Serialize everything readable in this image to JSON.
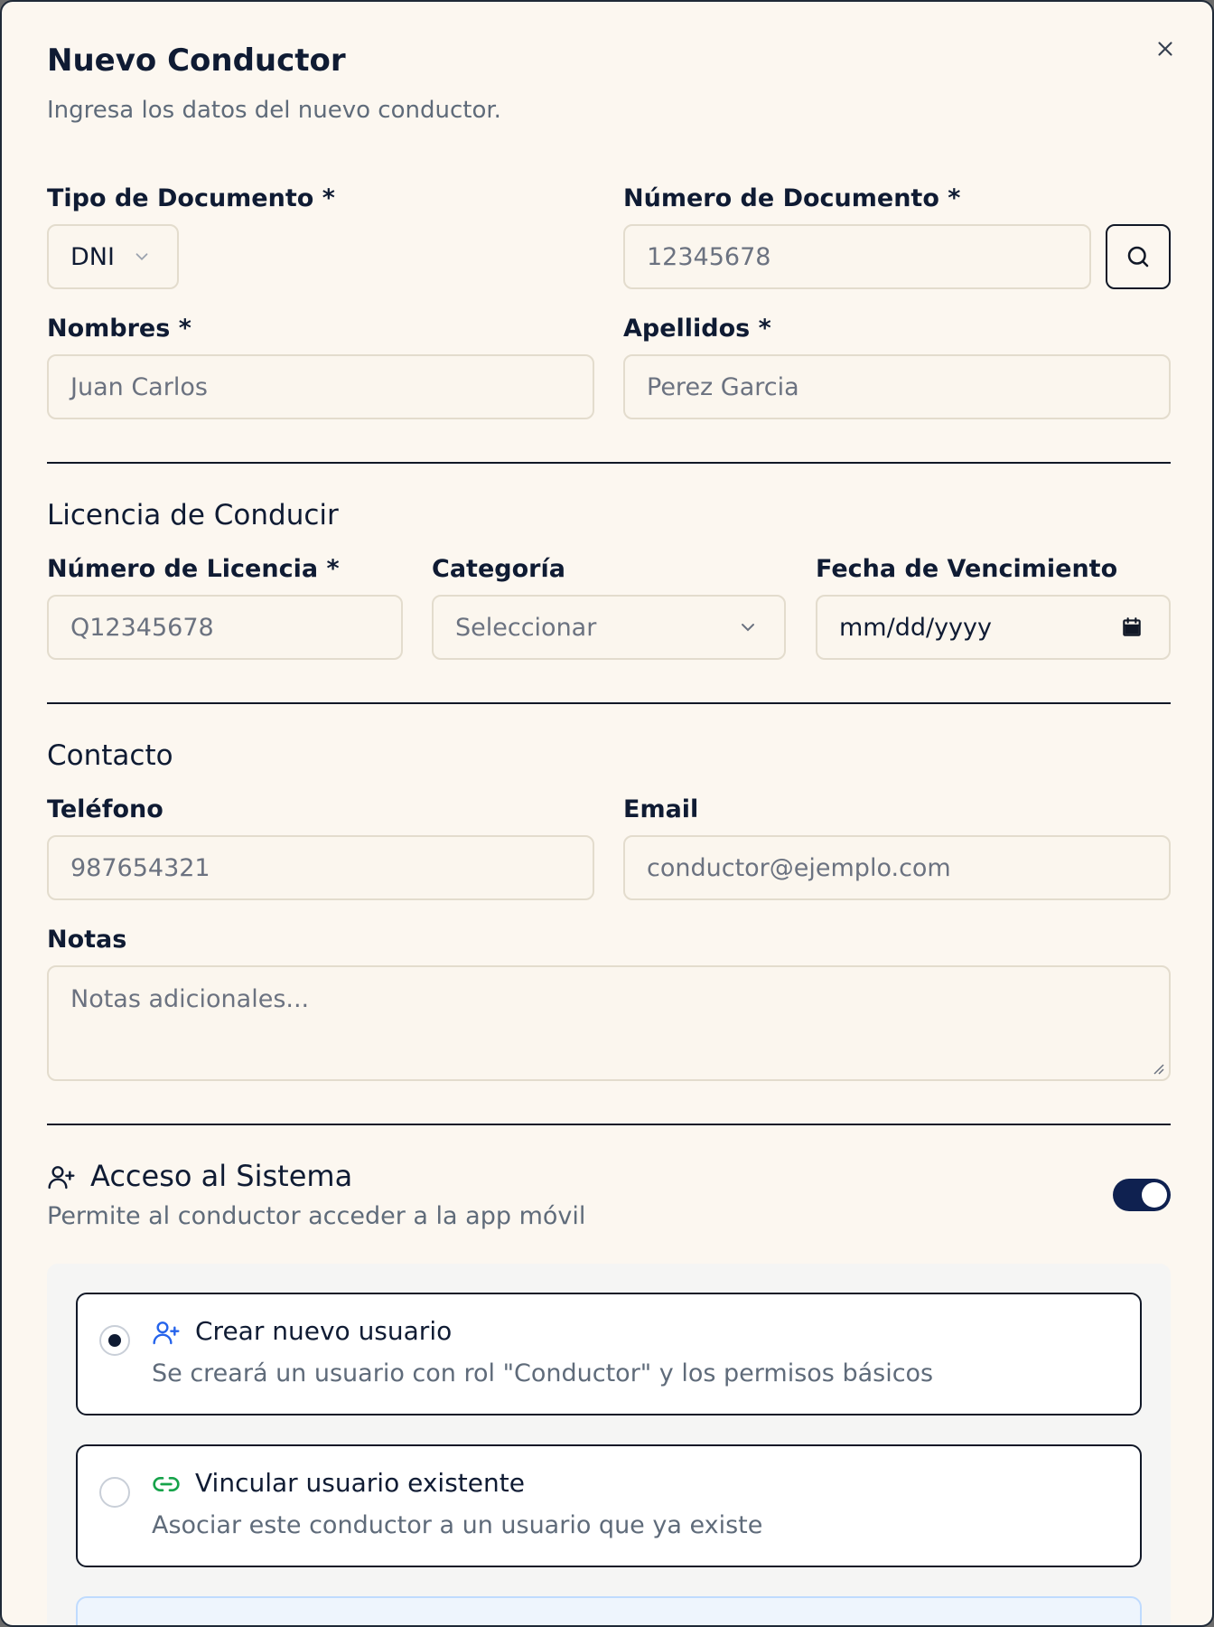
{
  "dialog": {
    "title": "Nuevo Conductor",
    "subtitle": "Ingresa los datos del nuevo conductor."
  },
  "personal": {
    "doc_type_label": "Tipo de Documento *",
    "doc_type_value": "DNI",
    "doc_number_label": "Número de Documento *",
    "doc_number_placeholder": "12345678",
    "first_name_label": "Nombres *",
    "first_name_placeholder": "Juan Carlos",
    "last_name_label": "Apellidos *",
    "last_name_placeholder": "Perez Garcia"
  },
  "license": {
    "section_title": "Licencia de Conducir",
    "number_label": "Número de Licencia *",
    "number_placeholder": "Q12345678",
    "category_label": "Categoría",
    "category_value": "Seleccionar",
    "expiry_label": "Fecha de Vencimiento",
    "expiry_placeholder": "mm/dd/yyyy"
  },
  "contact": {
    "section_title": "Contacto",
    "phone_label": "Teléfono",
    "phone_placeholder": "987654321",
    "email_label": "Email",
    "email_placeholder": "conductor@ejemplo.com",
    "notes_label": "Notas",
    "notes_placeholder": "Notas adicionales..."
  },
  "access": {
    "title": "Acceso al Sistema",
    "description": "Permite al conductor acceder a la app móvil",
    "enabled": true,
    "options": [
      {
        "title": "Crear nuevo usuario",
        "description": "Se creará un usuario con rol \"Conductor\" y los permisos básicos",
        "selected": true,
        "icon": "user-plus-icon"
      },
      {
        "title": "Vincular usuario existente",
        "description": "Asociar este conductor a un usuario que ya existe",
        "selected": false,
        "icon": "link-icon"
      }
    ]
  },
  "colors": {
    "background": "#fcf7f0",
    "text": "#0f1b33",
    "muted": "#5f6b7a",
    "toggle": "#0f2150",
    "user_icon": "#2563eb",
    "link_icon": "#16a34a"
  }
}
